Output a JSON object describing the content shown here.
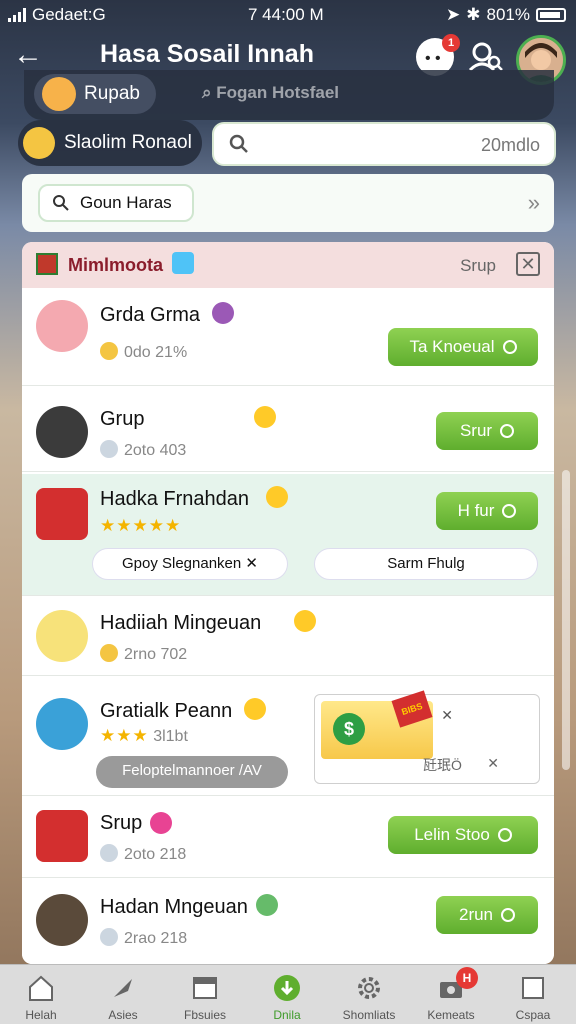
{
  "status_bar": {
    "carrier": "Gedaet:G",
    "time": "7 44:00 M",
    "battery": "801%"
  },
  "header": {
    "title": "Hasa Sosail Innah"
  },
  "chat_badge": "1",
  "tabs": {
    "active": "Rupab",
    "inactive": "Fogan Hotsfael"
  },
  "user_pill": "Slaolim Ronaol",
  "search": {
    "value": "20mdlo"
  },
  "filter": {
    "chip": "Goun Haras"
  },
  "group": {
    "name": "Mimlmoota",
    "label": "Srup"
  },
  "rows": [
    {
      "name": "Grda Grma",
      "meta": "0do 21%",
      "button": "Ta Knoeual"
    },
    {
      "name": "Grup",
      "meta": "2oto 403",
      "button": "Srur"
    },
    {
      "name": "Hadka Frnahdan",
      "stars": "★★★★★",
      "button": "H fur",
      "pill_left": "Gpoy Slegnanken",
      "pill_left_x": "✕",
      "pill_right": "Sarm Fhulg"
    },
    {
      "name": "Hadiiah Mingeuan",
      "meta": "2rno 702"
    },
    {
      "name": "Gratialk Peann",
      "stars": "★★★",
      "meta": "3l1bt",
      "pill": "Feloptelmannoer /AV",
      "promo_tag": "BIBS",
      "promo_x": "✕",
      "promo_text": "瓩珉Ö",
      "promo_x2": "✕"
    },
    {
      "name": "Srup",
      "meta": "2oto 218",
      "button": "Lelin Stoo"
    },
    {
      "name": "Hadan Mngeuan",
      "meta": "2rao 218",
      "button": "2run"
    }
  ],
  "nav": [
    {
      "label": "Helah",
      "icon": "home-icon"
    },
    {
      "label": "Asies",
      "icon": "pin-icon"
    },
    {
      "label": "Fbsuies",
      "icon": "calendar-icon"
    },
    {
      "label": "Dnila",
      "icon": "download-icon"
    },
    {
      "label": "Shomliats",
      "icon": "gear-icon"
    },
    {
      "label": "Kemeats",
      "icon": "camera-icon",
      "badge": "H"
    },
    {
      "label": "Cspaa",
      "icon": "square-icon"
    }
  ],
  "colors": {
    "accent_green": "#5fae2e",
    "badge_red": "#e53935",
    "group_name": "#8b1d2c"
  }
}
